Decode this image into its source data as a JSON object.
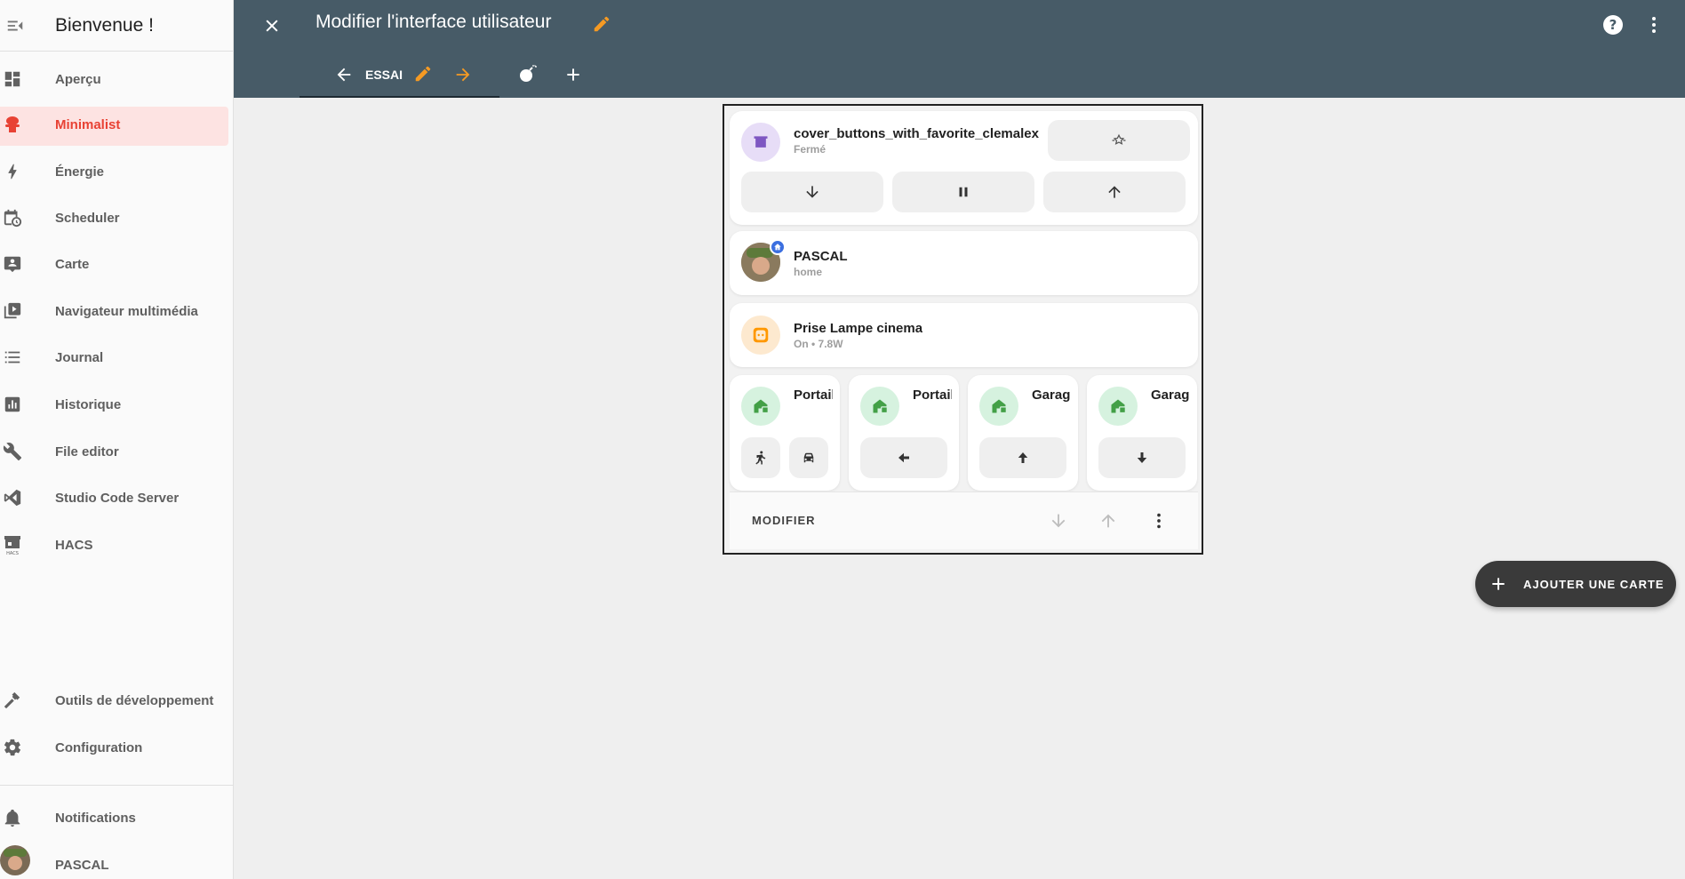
{
  "sidebar": {
    "title": "Bienvenue !",
    "items": [
      {
        "label": "Aperçu",
        "icon": "dashboard-icon"
      },
      {
        "label": "Minimalist",
        "icon": "minimalist-icon"
      },
      {
        "label": "Énergie",
        "icon": "lightning-icon"
      },
      {
        "label": "Scheduler",
        "icon": "calendar-clock-icon"
      },
      {
        "label": "Carte",
        "icon": "map-account-icon"
      },
      {
        "label": "Navigateur multimédia",
        "icon": "play-box-multiple-icon"
      },
      {
        "label": "Journal",
        "icon": "list-icon"
      },
      {
        "label": "Historique",
        "icon": "chart-box-icon"
      },
      {
        "label": "File editor",
        "icon": "wrench-icon"
      },
      {
        "label": "Studio Code Server",
        "icon": "vscode-icon"
      },
      {
        "label": "HACS",
        "icon": "hacs-icon"
      }
    ],
    "bottom_items": [
      {
        "label": "Outils de développement",
        "icon": "hammer-icon"
      },
      {
        "label": "Configuration",
        "icon": "gear-icon"
      },
      {
        "label": "Notifications",
        "icon": "bell-icon"
      },
      {
        "label": "PASCAL",
        "icon": "avatar"
      }
    ]
  },
  "header": {
    "title": "Modifier l'interface utilisateur",
    "tab_label": "ESSAI"
  },
  "cards": {
    "cover": {
      "name": "cover_buttons_with_favorite_clemalex",
      "state": "Fermé"
    },
    "person": {
      "name": "PASCAL",
      "state": "home"
    },
    "plug": {
      "name": "Prise Lampe cinema",
      "state": "On • 7.8W"
    },
    "gates": [
      {
        "name": "Portail"
      },
      {
        "name": "Portail"
      },
      {
        "name": "Garage"
      },
      {
        "name": "Garage"
      }
    ],
    "footer": {
      "modifier_label": "MODIFIER"
    }
  },
  "fab": {
    "label": "AJOUTER UNE CARTE"
  },
  "colors": {
    "header_bg": "#475b67",
    "accent_orange": "#f59a23",
    "active_red": "#e84234",
    "cover_purple": "#7e57c2",
    "gate_green": "#43a047",
    "plug_orange": "#ff9800"
  }
}
